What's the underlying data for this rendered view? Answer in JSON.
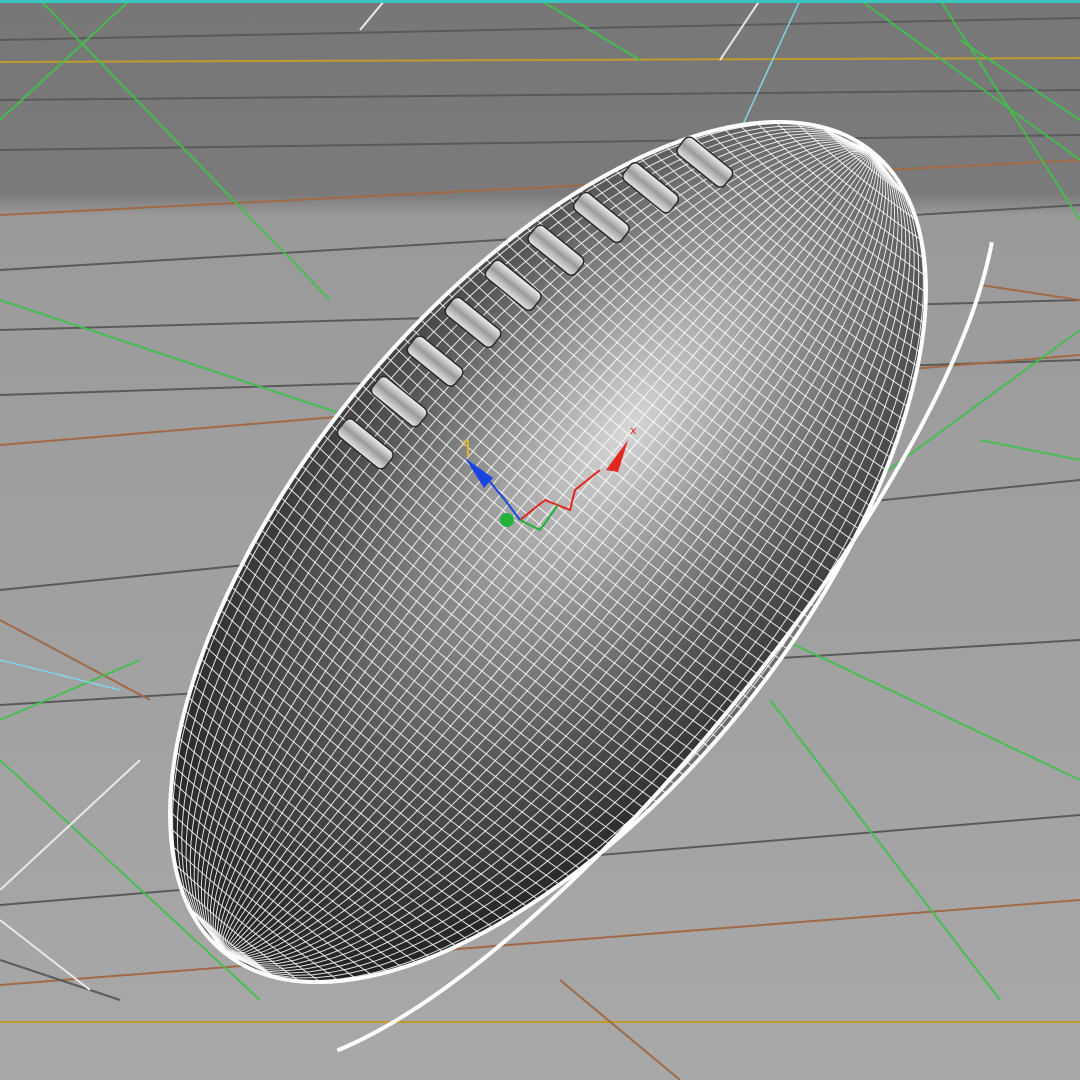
{
  "viewport": {
    "colors": {
      "background": "#8d8d8d",
      "grid_major_top": "#7a7a7a",
      "grid_major_bottom": "#a9a9a9",
      "grid_line_dark": "#5a5a5a",
      "grid_line_brown": "#a06a45",
      "grid_line_gold": "#c29a2a",
      "construction_green": "#3fc24a",
      "construction_cyan": "#7fd4e4",
      "construction_white": "#e8e8e8",
      "top_border_teal": "#39c6c0",
      "wire": "#ffffff",
      "ball_light": "#c9c9c9",
      "ball_dark": "#1d1d1d",
      "lace": "#d8d8d8"
    },
    "object": {
      "name_icon": "football-wireframe-mesh",
      "laces_count": 9
    },
    "gizmo": {
      "icon": "transform-gizmo-icon",
      "x_color": "#e0281d",
      "y_color": "#20b33a",
      "z_color": "#1a44e2",
      "labels": {
        "x": "x",
        "z": "z"
      }
    }
  }
}
